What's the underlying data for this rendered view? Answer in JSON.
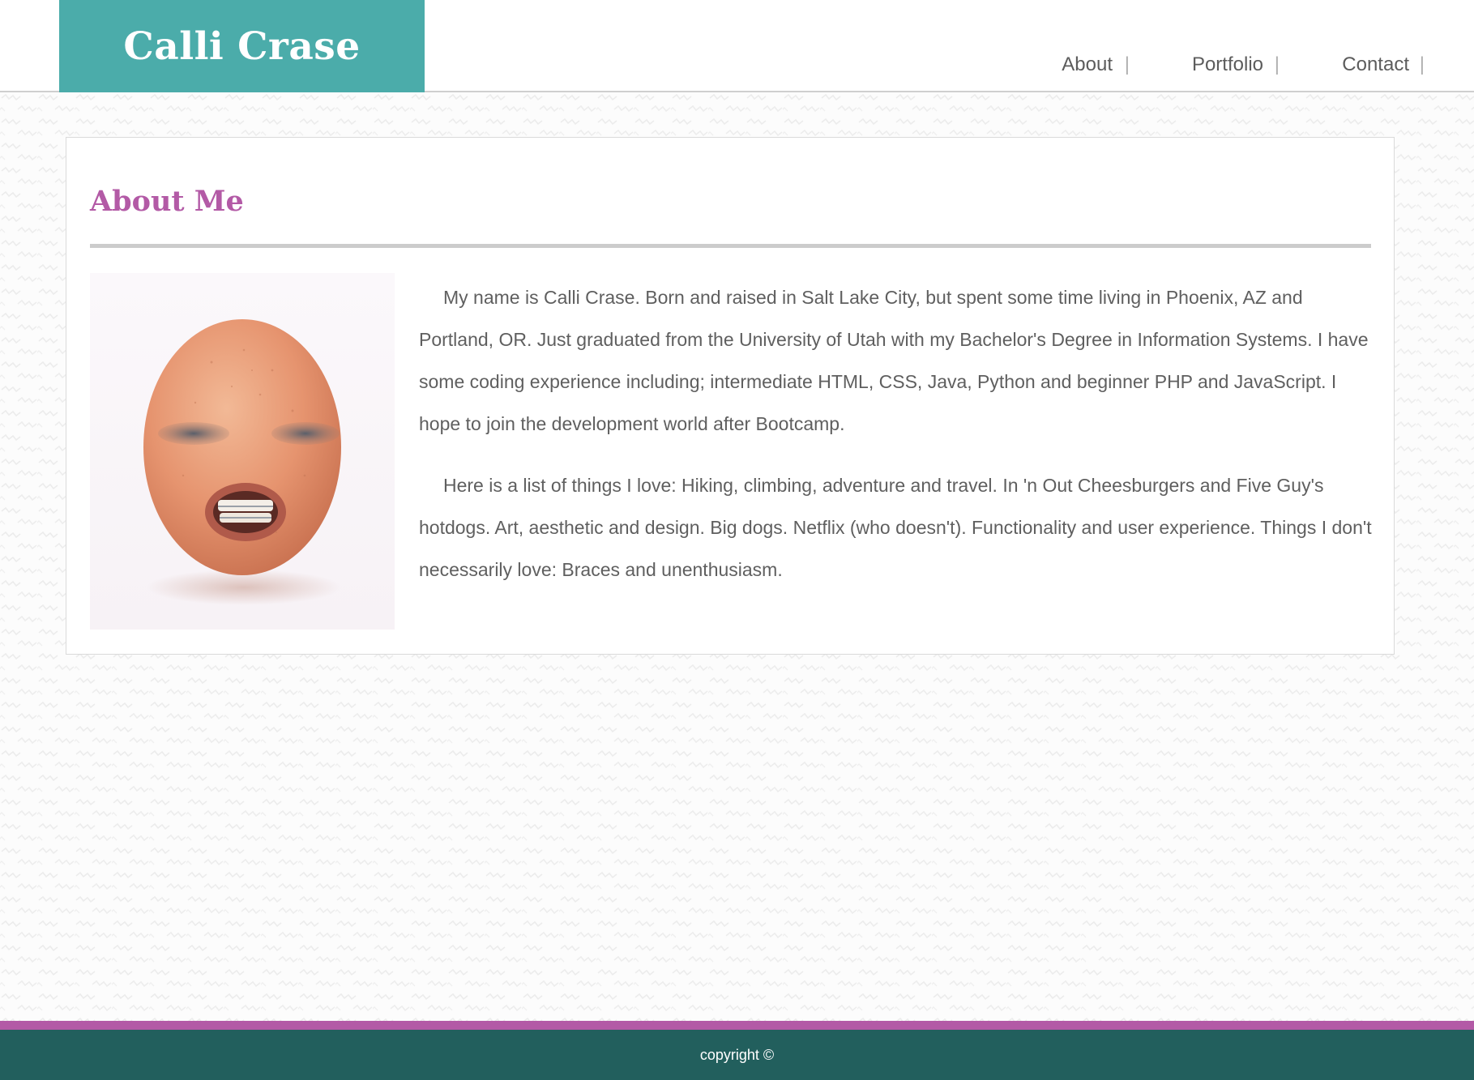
{
  "header": {
    "brand": "Calli Crase",
    "nav": [
      {
        "label": "About",
        "separator": "|"
      },
      {
        "label": "Portfolio",
        "separator": "|"
      },
      {
        "label": "Contact",
        "separator": "|"
      }
    ]
  },
  "about": {
    "title": "About Me",
    "paragraphs": [
      "My name is Calli Crase. Born and raised in Salt Lake City, but spent some time living in Phoenix, AZ and Portland, OR. Just graduated from the University of Utah with my Bachelor's Degree in Information Systems. I have some coding experience including; intermediate HTML, CSS, Java, Python and beginner PHP and JavaScript. I hope to join the development world after Bootcamp.",
      "Here is a list of things I love: Hiking, climbing, adventure and travel. In 'n Out Cheesburgers and Five Guy's hotdogs. Art, aesthetic and design. Big dogs. Netflix (who doesn't). Functionality and user experience. Things I don't necessarily love: Braces and unenthusiasm."
    ]
  },
  "footer": {
    "text": "copyright ©"
  },
  "colors": {
    "brand_bg": "#4bacaa",
    "heading": "#b35aa6",
    "footer_bg": "#225f5d",
    "footer_stripe": "#b35aa6"
  },
  "icons": {
    "profile_image": "egg-face-with-braces"
  }
}
